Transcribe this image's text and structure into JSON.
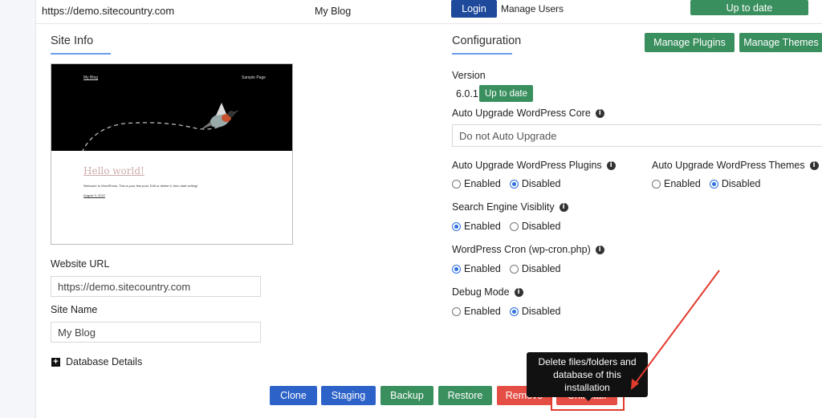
{
  "topbar": {
    "url": "https://demo.sitecountry.com",
    "blog_name": "My Blog",
    "login_label": "Login",
    "manage_users_label": "Manage Users",
    "status_label": "Up to date"
  },
  "site_info": {
    "title": "Site Info",
    "preview": {
      "nav_left": "My Blog",
      "nav_right": "Sample Page",
      "post_title": "Hello world!",
      "post_excerpt": "Welcome to WordPress. This is your first post. Edit or delete it, then start writing!",
      "post_date": "August 3, 2022"
    },
    "website_url_label": "Website URL",
    "website_url_value": "https://demo.sitecountry.com",
    "site_name_label": "Site Name",
    "site_name_value": "My Blog",
    "database_details_label": "Database Details"
  },
  "configuration": {
    "title": "Configuration",
    "manage_plugins_label": "Manage Plugins",
    "manage_themes_label": "Manage Themes",
    "version_label": "Version",
    "version_value": "6.0.1",
    "version_status": "Up to date",
    "auto_upgrade_core_label": "Auto Upgrade WordPress Core",
    "auto_upgrade_core_value": "Do not Auto Upgrade",
    "auto_upgrade_plugins_label": "Auto Upgrade WordPress Plugins",
    "auto_upgrade_themes_label": "Auto Upgrade WordPress Themes",
    "search_engine_label": "Search Engine Visiblity",
    "cron_label": "WordPress Cron (wp-cron.php)",
    "debug_label": "Debug Mode",
    "enabled_label": "Enabled",
    "disabled_label": "Disabled",
    "plugins_selected": "Disabled",
    "themes_selected": "Disabled",
    "search_selected": "Enabled",
    "cron_selected": "Enabled",
    "debug_selected": "Disabled"
  },
  "actions": {
    "clone": "Clone",
    "staging": "Staging",
    "backup": "Backup",
    "restore": "Restore",
    "remove": "Remove",
    "uninstall": "Uninstall",
    "tooltip_line1": "Delete files/folders and",
    "tooltip_line2": "database of this installation"
  },
  "colors": {
    "navy": "#1f4a9c",
    "green": "#3a8f5e",
    "blue": "#2d63c8",
    "red": "#e54e45",
    "annotation": "#e23b2e"
  },
  "icons": [
    "info-icon",
    "plus-square-icon",
    "annotation-arrow",
    "bird-illustration"
  ]
}
